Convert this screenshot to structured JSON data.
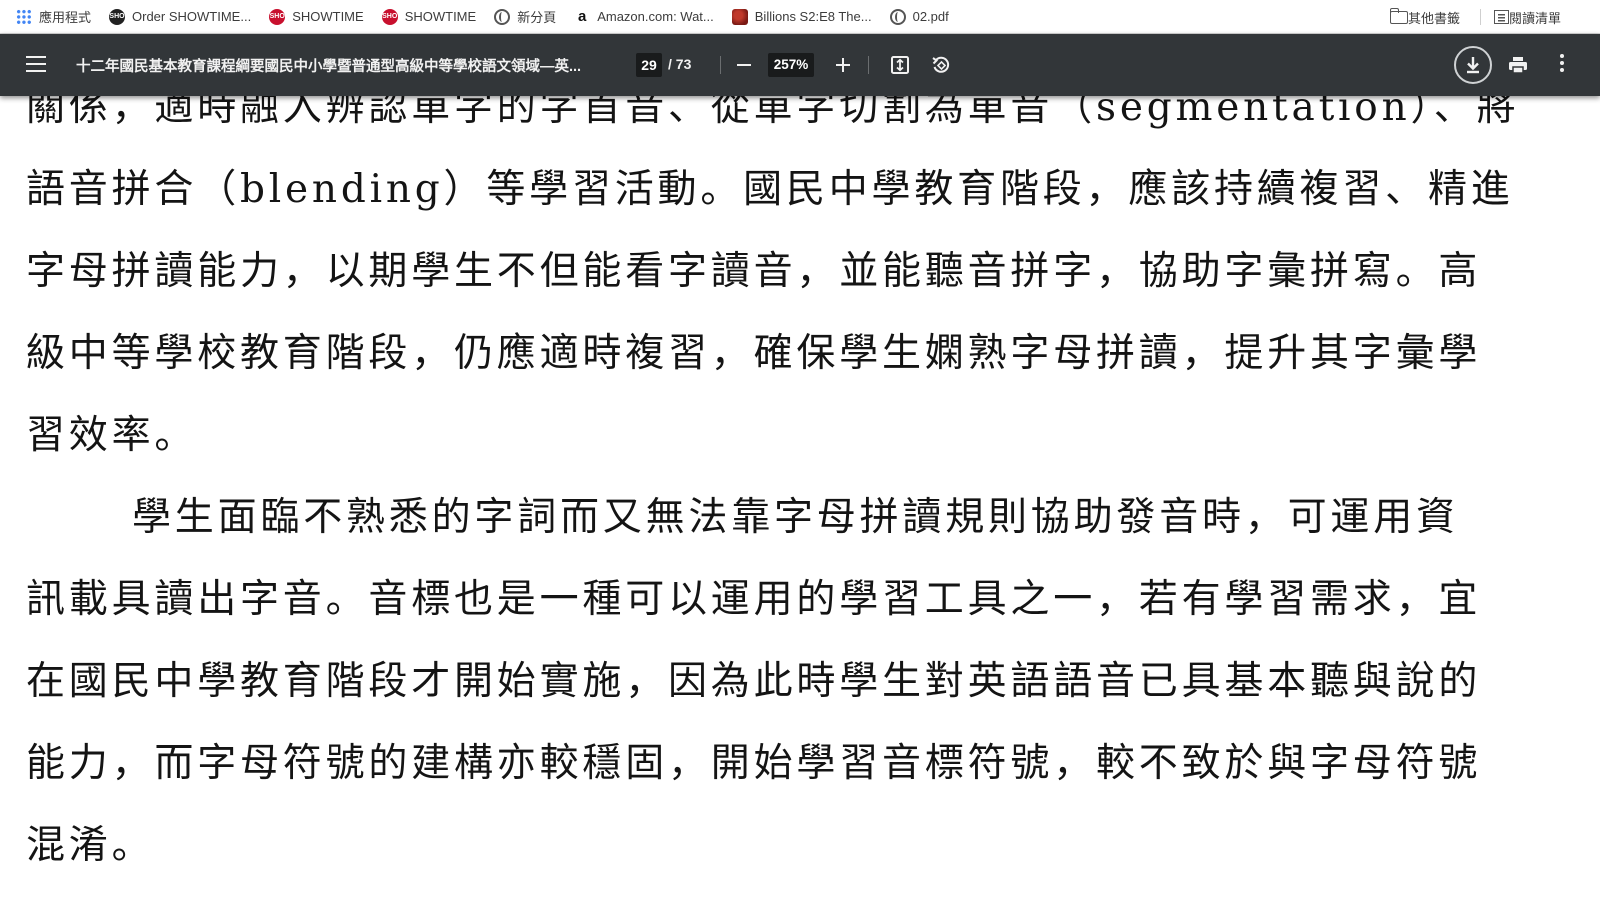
{
  "bookmarks_bar": {
    "items": [
      {
        "label": "應用程式",
        "icon": "apps-icon"
      },
      {
        "label": "Order SHOWTIME...",
        "icon": "showtime-icon"
      },
      {
        "label": "SHOWTIME",
        "icon": "showtime-icon"
      },
      {
        "label": "SHOWTIME",
        "icon": "showtime-icon"
      },
      {
        "label": "新分頁",
        "icon": "globe-icon"
      },
      {
        "label": "Amazon.com: Wat...",
        "icon": "amazon-icon"
      },
      {
        "label": "Billions S2:E8 The...",
        "icon": "billions-icon"
      },
      {
        "label": "02.pdf",
        "icon": "globe-icon"
      }
    ],
    "other_bookmarks": "其他書籤",
    "reading_list": "閱讀清單"
  },
  "pdf_toolbar": {
    "title": "十二年國民基本教育課程綱要國民中小學暨普通型高級中等學校語文領域—英...",
    "current_page": "29",
    "total_pages": "/ 73",
    "zoom": "257%"
  },
  "document": {
    "lines": [
      "關係，適時融入辨認單字的字首音、從單字切割為單音（segmentation）、將",
      "語音拼合（blending）等學習活動。國民中學教育階段，應該持續複習、精進",
      "字母拼讀能力，以期學生不但能看字讀音，並能聽音拼字，協助字彙拼寫。高",
      "級中等學校教育階段，仍應適時複習，確保學生嫻熟字母拼讀，提升其字彙學",
      "習效率。",
      "學生面臨不熟悉的字詞而又無法靠字母拼讀規則協助發音時，可運用資",
      "訊載具讀出字音。音標也是一種可以運用的學習工具之一，若有學習需求，宜",
      "在國民中學教育階段才開始實施，因為此時學生對英語語音已具基本聽與說的",
      "能力，而字母符號的建構亦較穩固，開始學習音標符號，較不致於與字母符號",
      "混淆。"
    ]
  },
  "colors": {
    "toolbar_bg": "#323639",
    "toolbar_text": "#f1f1f1",
    "page_bg": "#ffffff",
    "text": "#141414"
  }
}
